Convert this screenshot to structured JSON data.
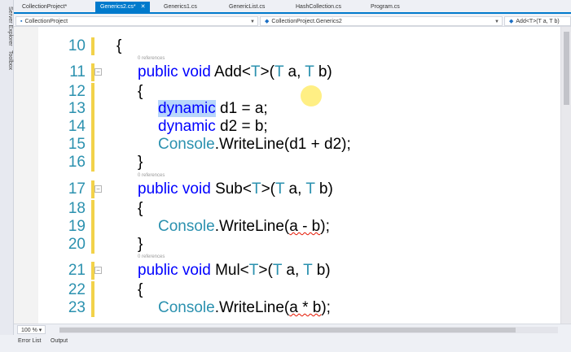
{
  "side_tabs": {
    "server_explorer": "Server Explorer",
    "toolbox": "Toolbox"
  },
  "tabs": [
    {
      "label": "CollectionProject*",
      "active": false
    },
    {
      "label": "Generics2.cs*",
      "active": true
    },
    {
      "label": "Generics1.cs",
      "active": false
    },
    {
      "label": "GenericList.cs",
      "active": false
    },
    {
      "label": "HashCollection.cs",
      "active": false
    },
    {
      "label": "Program.cs",
      "active": false
    }
  ],
  "nav": {
    "project": "CollectionProject",
    "class": "CollectionProject.Generics2",
    "member": "Add<T>(T a, T b)"
  },
  "references_label": "0 references",
  "code": {
    "l10": {
      "num": "10",
      "text": "{"
    },
    "l11": {
      "num": "11",
      "kw": "public void",
      "name": "Add<",
      "t1": "T",
      "mid": ">(",
      "t2": "T",
      "a": " a, ",
      "t3": "T",
      "b": " b)"
    },
    "l12": {
      "num": "12",
      "text": "{"
    },
    "l13": {
      "num": "13",
      "kw": "dynamic",
      "rest": " d1 = a;"
    },
    "l14": {
      "num": "14",
      "kw": "dynamic",
      "rest": " d2 = b;"
    },
    "l15": {
      "num": "15",
      "ty": "Console",
      "rest": ".WriteLine(d1 + d2);"
    },
    "l16": {
      "num": "16",
      "text": "}"
    },
    "l17": {
      "num": "17",
      "kw": "public void",
      "name": "Sub<",
      "t1": "T",
      "mid": ">(",
      "t2": "T",
      "a": " a, ",
      "t3": "T",
      "b": " b)"
    },
    "l18": {
      "num": "18",
      "text": "{"
    },
    "l19": {
      "num": "19",
      "ty": "Console",
      "pre": ".WriteLine(",
      "sq": "a - b",
      "post": ");"
    },
    "l20": {
      "num": "20",
      "text": "}"
    },
    "l21": {
      "num": "21",
      "kw": "public void",
      "name": "Mul<",
      "t1": "T",
      "mid": ">(",
      "t2": "T",
      "a": " a, ",
      "t3": "T",
      "b": " b)"
    },
    "l22": {
      "num": "22",
      "text": "{"
    },
    "l23": {
      "num": "23",
      "ty": "Console",
      "pre": ".WriteLine(",
      "sq": "a * b",
      "post": ");"
    }
  },
  "status": {
    "zoom": "100 %"
  },
  "bottom_tabs": {
    "error_list": "Error List",
    "output": "Output"
  },
  "colors": {
    "keyword": "#0000ff",
    "type": "#2b91af",
    "line_number": "#2b91af",
    "accent": "#007acc"
  }
}
